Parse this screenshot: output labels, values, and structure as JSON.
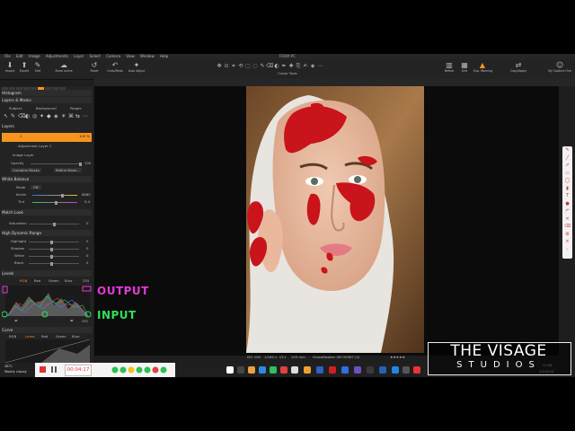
{
  "menu": [
    "File",
    "Edit",
    "Image",
    "Adjustments",
    "Layer",
    "Select",
    "Camera",
    "View",
    "Window",
    "Help"
  ],
  "window_title": "FROM PC",
  "toolbar_left": [
    {
      "label": "Import",
      "icon": "import-icon"
    },
    {
      "label": "Export",
      "icon": "export-icon"
    },
    {
      "label": "Edit",
      "icon": "edit-icon"
    },
    {
      "label": "Show online",
      "icon": "show-online-icon"
    },
    {
      "label": "Reset",
      "icon": "reset-icon"
    },
    {
      "label": "Undo/Redo",
      "icon": "undo-redo-icon"
    },
    {
      "label": "Auto Adjust",
      "icon": "auto-adjust-icon"
    }
  ],
  "cursor_tools_label": "Cursor Tools",
  "toolbar_right": [
    {
      "label": "Before",
      "icon": "before-icon"
    },
    {
      "label": "Grid",
      "icon": "grid-icon"
    },
    {
      "label": "Exp. Warning",
      "icon": "warning-icon"
    },
    {
      "label": "Copy/Apply",
      "icon": "copy-apply-icon"
    },
    {
      "label": "My Capture One",
      "icon": "user-icon"
    }
  ],
  "left_panel": {
    "histogram": "Histogram",
    "layers_masks": "Layers & Masks",
    "mask_buttons": [
      "Subject",
      "Background",
      "People"
    ],
    "layers_label": "Layers",
    "active_layer": "1",
    "active_layer_value": "100 %",
    "adjustment_layer": "Adjustment Layer 1",
    "adjustment_layer_value": "100 %",
    "image_layer": "Image Layer",
    "opacity_label": "Opacity",
    "opacity_value": "100",
    "combine_masks": "Combine Masks",
    "refine_mask": "Refine Mask...",
    "white_balance": "White Balance",
    "wb_mode_label": "Mode",
    "wb_mode_value": "Off",
    "wb_kelvin_label": "Kelvin",
    "wb_kelvin_value": "6880",
    "wb_tint_label": "Tint",
    "wb_tint_value": "0.4",
    "match_look": "Match Look",
    "saturation_label": "Saturation",
    "saturation_value": "0",
    "hdr": "High Dynamic Range",
    "hdr_rows": [
      {
        "label": "Highlight",
        "value": "0"
      },
      {
        "label": "Shadow",
        "value": "0"
      },
      {
        "label": "White",
        "value": "0"
      },
      {
        "label": "Black",
        "value": "0"
      }
    ],
    "levels": "Levels",
    "levels_tabs": [
      "RGB",
      "Red",
      "Green",
      "Blue"
    ],
    "levels_right_value": "255",
    "levels_bottom_value": "255",
    "curve": "Curve",
    "curve_tabs": [
      "RGB",
      "Luma",
      "Red",
      "Green",
      "Blue"
    ]
  },
  "photo_info": {
    "iso": "ISO 100",
    "shutter": "1/160 s",
    "aperture": "f/11",
    "focal": "105 mm",
    "filename": "GraceBowker 08720967 (2)"
  },
  "overlay": {
    "output_label": "OUTPUT",
    "input_label": "INPUT"
  },
  "taskbar": {
    "weather_temp": "28°C",
    "weather_desc": "Mostly cloudy",
    "timer": "00:04:17",
    "time": "11:06",
    "date": "1/1/2024"
  },
  "watermark": {
    "title": "THE VISAGE",
    "subtitle": "STUDIOS"
  },
  "colors": {
    "accent_orange": "#f7941d",
    "output_magenta": "#e23ad8",
    "input_green": "#2fe05a",
    "mask_red": "#c8141a"
  }
}
